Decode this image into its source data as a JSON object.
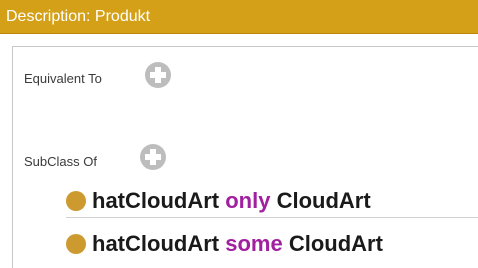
{
  "header": {
    "title": "Description: Produkt"
  },
  "sections": {
    "equivalent_to": {
      "label": "Equivalent To"
    },
    "subclass_of": {
      "label": "SubClass Of",
      "axioms": [
        {
          "property": "hatCloudArt",
          "keyword": "only",
          "filler": "CloudArt"
        },
        {
          "property": "hatCloudArt",
          "keyword": "some",
          "filler": "CloudArt"
        }
      ]
    }
  },
  "colors": {
    "header_bg": "#d4a017",
    "keyword": "#a020a0",
    "bullet": "#cc9a2f",
    "add_button": "#bdbdbd"
  },
  "icons": {
    "add": "plus-circle-icon",
    "bullet": "class-bullet-icon"
  }
}
